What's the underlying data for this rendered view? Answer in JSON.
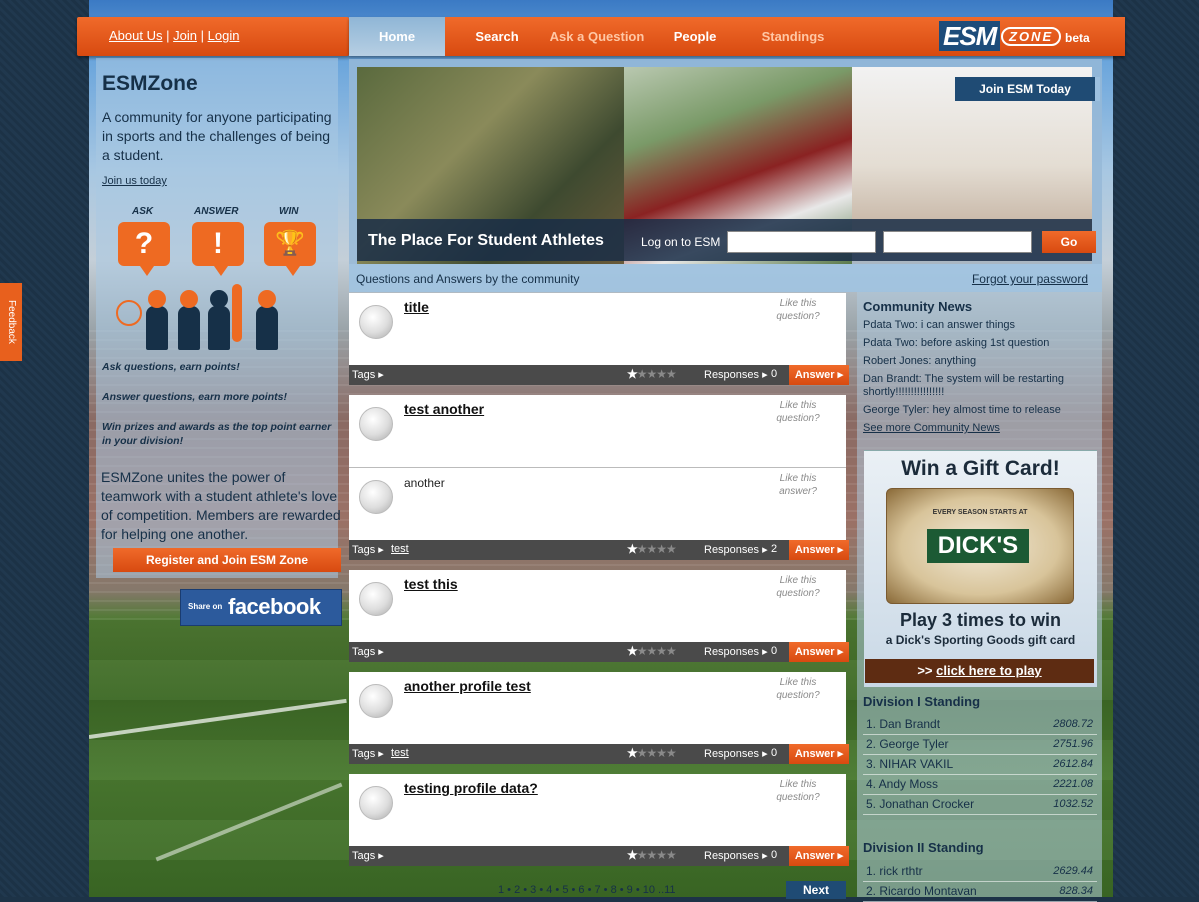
{
  "toplinks": {
    "about": "About Us",
    "sep1": "|",
    "join": "Join",
    "sep2": "|",
    "login": "Login"
  },
  "nav": {
    "home": "Home",
    "search": "Search",
    "ask": "Ask a Question",
    "people": "People",
    "standings": "Standings"
  },
  "logo": {
    "esm": "ESM",
    "zone": "ZONE",
    "beta": "beta"
  },
  "feedback": "Feedback",
  "left": {
    "title": "ESMZone",
    "description": "A community for anyone participating in sports and the challenges of being a student.",
    "join_link": "Join us today",
    "labels": {
      "ask": "ASK",
      "answer": "ANSWER",
      "win": "WIN"
    },
    "bubbles": {
      "ask": "?",
      "answer": "!",
      "win": "🏆"
    },
    "bullets": [
      "Ask questions, earn points!",
      "Answer questions, earn more points!",
      "Win prizes and awards as the top point earner in your division!"
    ],
    "unites": "ESMZone unites the power of teamwork with a student athlete's love of competition. Members are rewarded for helping one another.",
    "register_button": "Register and Join ESM Zone",
    "facebook": {
      "share": "Share on",
      "brand": "facebook"
    }
  },
  "hero": {
    "join_button": "Join ESM Today",
    "tagline": "The Place For Student Athletes",
    "logon_label": "Log on to ESM",
    "go_button": "Go"
  },
  "subbar": {
    "left": "Questions and Answers by the community",
    "forgot": "Forgot your password"
  },
  "questions": [
    {
      "title": "title",
      "like": "Like this question?",
      "tags_label": "Tags",
      "tag": "",
      "responses_label": "Responses",
      "responses": "0",
      "answer_button": "Answer"
    },
    {
      "title": "test another",
      "like": "Like this question?",
      "answer_text": "another",
      "answer_like": "Like this answer?",
      "tags_label": "Tags",
      "tag": "test",
      "responses_label": "Responses",
      "responses": "2",
      "answer_button": "Answer"
    },
    {
      "title": "test this",
      "like": "Like this question?",
      "tags_label": "Tags",
      "tag": "",
      "responses_label": "Responses",
      "responses": "0",
      "answer_button": "Answer"
    },
    {
      "title": "another profile test",
      "like": "Like this question?",
      "tags_label": "Tags",
      "tag": "test",
      "responses_label": "Responses",
      "responses": "0",
      "answer_button": "Answer"
    },
    {
      "title": "testing profile data?",
      "like": "Like this question?",
      "tags_label": "Tags",
      "tag": "",
      "responses_label": "Responses",
      "responses": "0",
      "answer_button": "Answer"
    }
  ],
  "rating": {
    "filled": 1,
    "max": 5
  },
  "pager": {
    "pages": "1 • 2 • 3 • 4 • 5 • 6 • 7 • 8 • 9 • 10 ..11",
    "next": "Next"
  },
  "news": {
    "heading": "Community News",
    "items": [
      "Pdata Two: i can answer things",
      "Pdata Two: before asking 1st question",
      "Robert Jones: anything",
      "Dan Brandt: The system will be restarting shortly!!!!!!!!!!!!!!!!",
      "George Tyler: hey almost time to release"
    ],
    "more": "See more Community News"
  },
  "gift": {
    "heading": "Win a Gift Card!",
    "card_tagline": "EVERY SEASON STARTS AT",
    "card_brand": "DICK'S",
    "play": "Play 3 times to win",
    "sub": "a Dick's Sporting Goods gift card",
    "cta_prefix": ">>",
    "cta": "click here to play"
  },
  "division1": {
    "heading": "Division I Standing",
    "rows": [
      {
        "name": "1. Dan Brandt",
        "score": "2808.72"
      },
      {
        "name": "2. George Tyler",
        "score": "2751.96"
      },
      {
        "name": "3. NIHAR VAKIL",
        "score": "2612.84"
      },
      {
        "name": "4. Andy Moss",
        "score": "2221.08"
      },
      {
        "name": "5. Jonathan Crocker",
        "score": "1032.52"
      }
    ]
  },
  "division2": {
    "heading": "Division II Standing",
    "rows": [
      {
        "name": "1. rick rthtr",
        "score": "2629.44"
      },
      {
        "name": "2. Ricardo Montavan",
        "score": "828.34"
      }
    ]
  },
  "colors": {
    "orange": "#ee6a22",
    "navy": "#1f4b74",
    "text": "#163048"
  }
}
